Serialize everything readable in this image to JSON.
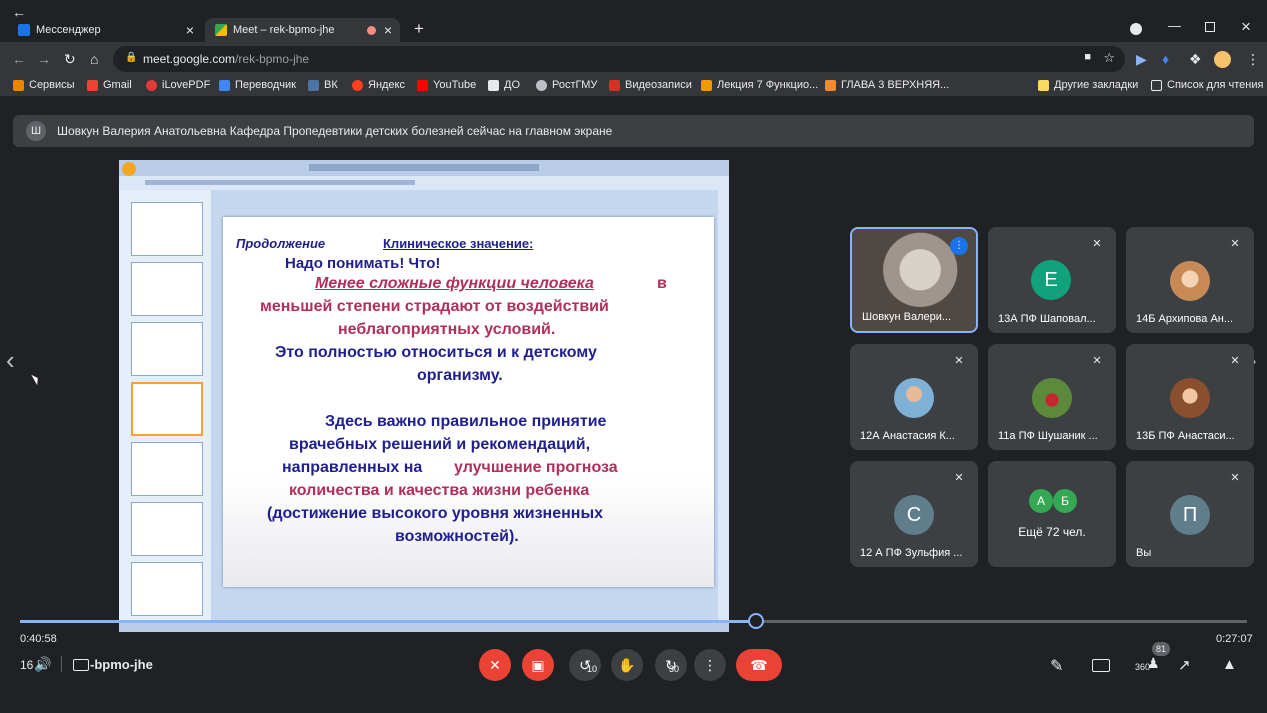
{
  "browser": {
    "tabs": [
      {
        "label": "Мессенджер",
        "active": false
      },
      {
        "label": "Meet – rek-bpmo-jhe",
        "active": true
      }
    ],
    "new_tab_icon": "plus-icon",
    "url_host": "meet.google.com",
    "url_path": "/rek-bpmo-jhe",
    "bookmarks": [
      "Сервисы",
      "Gmail",
      "iLovePDF",
      "Переводчик",
      "ВК",
      "Яндекс",
      "YouTube",
      "ДО",
      "РостГМУ",
      "Видеозаписи",
      "Лекция 7 Функцио...",
      "ГЛАВА 3 ВЕРХНЯЯ..."
    ],
    "bookmarks_right": [
      "Другие закладки",
      "Список для чтения"
    ]
  },
  "meet": {
    "presenter_initial": "Ш",
    "presenter_banner": "Шовкун Валерия Анатольевна Кафедра Пропедевтики детских болезней сейчас на главном экране",
    "slide": {
      "line1_left": "Продолжение",
      "line1_right": "Клиническое значение:",
      "line2": "Надо понимать! Что!",
      "line3a": "Менее сложные функции человека",
      "line3b": "в",
      "line4": "меньшей степени страдают от воздействий",
      "line5": "неблагоприятных условий.",
      "line6": "Это полностью относиться  и к детскому",
      "line7": "организму.",
      "line8": "Здесь важно правильное принятие",
      "line9": "врачебных решений и рекомендаций,",
      "line10a": "направленных на",
      "line10b": "улучшение  прогноза",
      "line11": "количества и качества жизни ребенка",
      "line12": "(достижение высокого уровня жизненных",
      "line13": "возможностей)."
    },
    "participants": [
      {
        "name": "Шовкун Валери...",
        "initial": "",
        "muted": false
      },
      {
        "name": "13А ПФ Шаповал...",
        "initial": "Е",
        "muted": true
      },
      {
        "name": "14Б Архипова Ан...",
        "initial": "",
        "muted": true
      },
      {
        "name": "12А Анастасия К...",
        "initial": "",
        "muted": true
      },
      {
        "name": "11а ПФ Шушаник ...",
        "initial": "",
        "muted": true
      },
      {
        "name": "13Б ПФ Анастаси...",
        "initial": "",
        "muted": true
      },
      {
        "name": "12 А ПФ Зульфия ...",
        "initial": "С",
        "muted": true
      },
      {
        "name": "Ещё 72 чел.",
        "initial": "",
        "muted": false
      },
      {
        "name": "Вы",
        "initial": "П",
        "muted": true
      }
    ],
    "more_avatars": [
      "А",
      "Б"
    ],
    "meeting_code": "-bpmo-jhe",
    "people_count": "81",
    "colors": {
      "accent": "#8ab4f8",
      "end_call": "#ea4335",
      "tile_bg": "#3c4043"
    }
  },
  "player": {
    "time_current": "0:40:58",
    "time_total": "0:27:07",
    "progress": 0.6,
    "overlay_left": "16",
    "rewind_label": "10",
    "forward_label": "30",
    "speed_label": "360"
  }
}
